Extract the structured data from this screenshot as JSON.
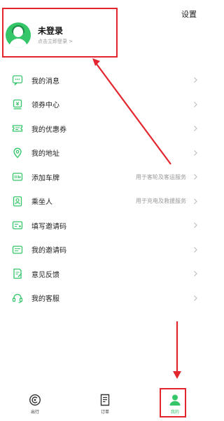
{
  "header": {
    "settings_label": "设置",
    "profile_name": "未登录",
    "profile_sub": "点击立即登录 >"
  },
  "menu": {
    "items": [
      {
        "label": "我的消息",
        "hint": "",
        "icon": "message-icon"
      },
      {
        "label": "领券中心",
        "hint": "",
        "icon": "coupon-center-icon"
      },
      {
        "label": "我的优惠券",
        "hint": "",
        "icon": "ticket-icon"
      },
      {
        "label": "我的地址",
        "hint": "",
        "icon": "location-pin-icon"
      },
      {
        "label": "添加车牌",
        "hint": "用于客轮及客运服务",
        "icon": "license-plate-icon"
      },
      {
        "label": "乘坐人",
        "hint": "用于充电及救援服务",
        "icon": "passenger-icon"
      },
      {
        "label": "填写邀请码",
        "hint": "",
        "icon": "enter-code-icon"
      },
      {
        "label": "我的邀请码",
        "hint": "",
        "icon": "invite-code-icon"
      },
      {
        "label": "意见反馈",
        "hint": "",
        "icon": "feedback-icon"
      },
      {
        "label": "我的客服",
        "hint": "",
        "icon": "headset-icon"
      }
    ]
  },
  "tabbar": {
    "tabs": [
      {
        "label": "出行",
        "icon": "travel-icon",
        "active": false
      },
      {
        "label": "订单",
        "icon": "order-icon",
        "active": false
      },
      {
        "label": "我的",
        "icon": "user-icon",
        "active": true
      }
    ]
  },
  "colors": {
    "accent": "#35c66a",
    "annotation": "#e3262e"
  }
}
